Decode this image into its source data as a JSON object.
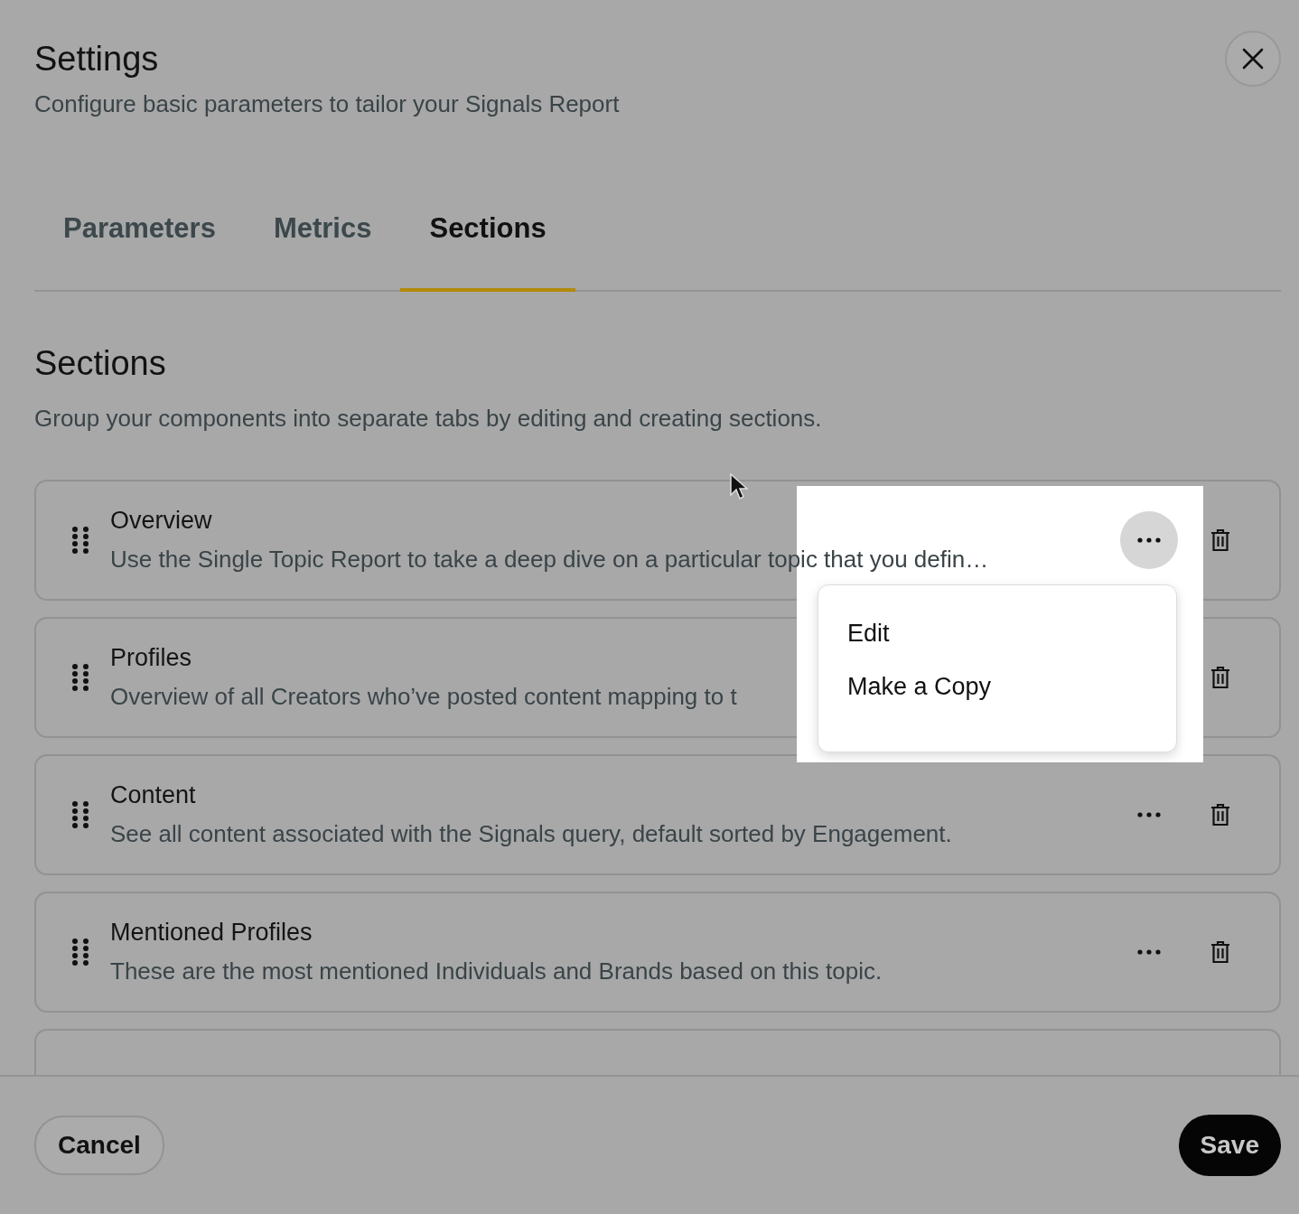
{
  "dialog": {
    "title": "Settings",
    "subtitle": "Configure basic parameters to tailor your Signals Report"
  },
  "tabs": [
    {
      "label": "Parameters",
      "selected": false
    },
    {
      "label": "Metrics",
      "selected": false
    },
    {
      "label": "Sections",
      "selected": true
    }
  ],
  "section": {
    "heading": "Sections",
    "description": "Group your components into separate tabs by editing and creating sections."
  },
  "rows": [
    {
      "title": "Overview",
      "description": "Use the Single Topic Report to take a deep dive on a particular topic that you defin…",
      "menu_open": true
    },
    {
      "title": "Profiles",
      "description": "Overview of all Creators who’ve posted content mapping to t",
      "menu_open": false
    },
    {
      "title": "Content",
      "description": "See all content associated with the Signals query, default sorted by Engagement.",
      "menu_open": false
    },
    {
      "title": "Mentioned Profiles",
      "description": "These are the most mentioned Individuals and Brands based on this topic.",
      "menu_open": false
    },
    {}
  ],
  "menu": {
    "items": [
      "Edit",
      "Make a Copy"
    ]
  },
  "footer": {
    "cancel": "Cancel",
    "save": "Save"
  }
}
